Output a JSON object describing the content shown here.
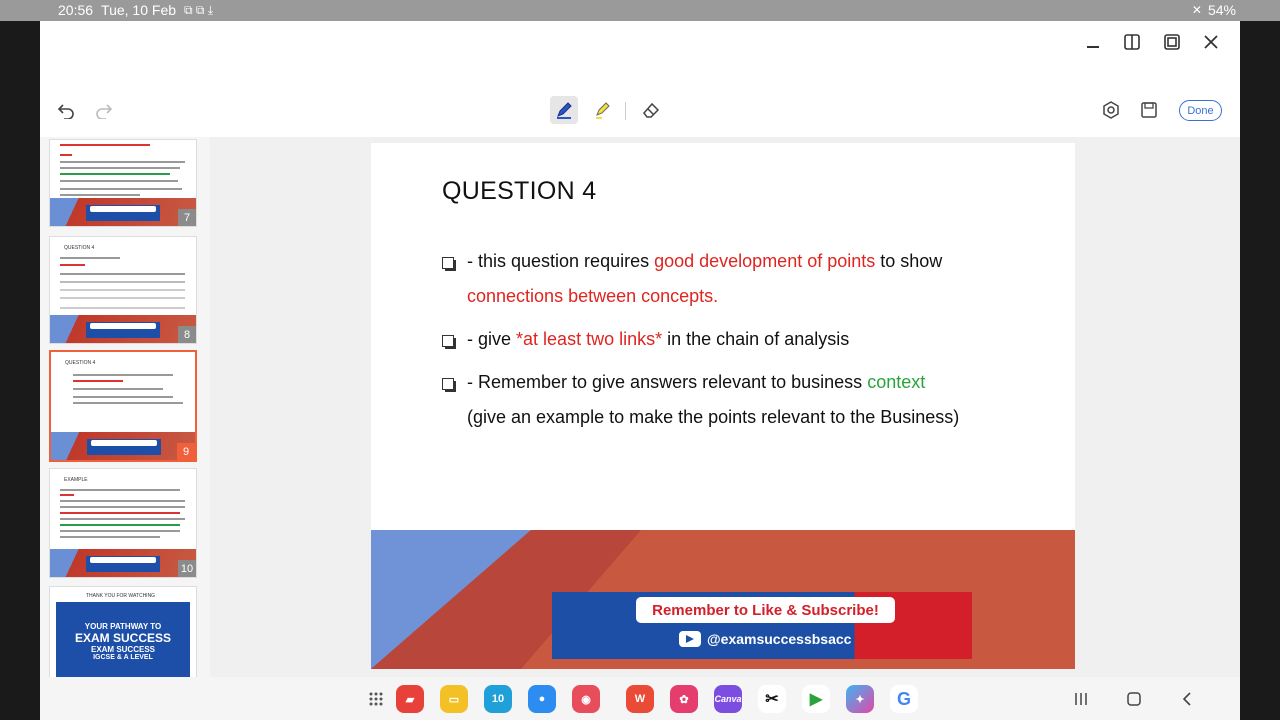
{
  "status": {
    "time": "20:56",
    "date": "Tue, 10 Feb",
    "battery": "54%"
  },
  "toolbar": {
    "done_label": "Done"
  },
  "thumbnails": [
    {
      "number": "7"
    },
    {
      "number": "8",
      "title": "QUESTION 4"
    },
    {
      "number": "9",
      "title": "QUESTION 4"
    },
    {
      "number": "10",
      "title": "EXAMPLE"
    },
    {
      "title": "THANK YOU FOR WATCHING",
      "line1": "YOUR PATHWAY TO",
      "line2": "EXAM SUCCESS",
      "line3": "EXAM SUCCESS",
      "line4": "IGCSE & A LEVEL"
    }
  ],
  "slide": {
    "title": "QUESTION 4",
    "bullet1_a": "- this question requires ",
    "bullet1_b": "good development of points",
    "bullet1_c": " to show",
    "bullet1_d": "connections between concepts.",
    "bullet2_a": "- give ",
    "bullet2_b": "*at least two links*",
    "bullet2_c": " in the chain of analysis",
    "bullet3_a": "- Remember to give answers relevant to business ",
    "bullet3_b": "context",
    "bullet3_c": "(give an example to make the points relevant to the Business)",
    "banner_cta": "Remember to Like & Subscribe!",
    "banner_handle": "@examsuccessbsacc"
  },
  "dock": {
    "apps": [
      "notes-app",
      "files-app",
      "calendar-app",
      "messages-app",
      "camera-app",
      "wps-app",
      "flower-app",
      "canva-app",
      "capcut-app",
      "play-store-app",
      "copilot-app",
      "google-app"
    ],
    "calendar_day": "10",
    "canva_label": "Canva"
  },
  "colors": {
    "accent_red": "#e0241f",
    "accent_green": "#2aa33a",
    "brand_blue": "#1e4fa6",
    "done_blue": "#3a6fd8",
    "active_thumb": "#f0603a"
  }
}
